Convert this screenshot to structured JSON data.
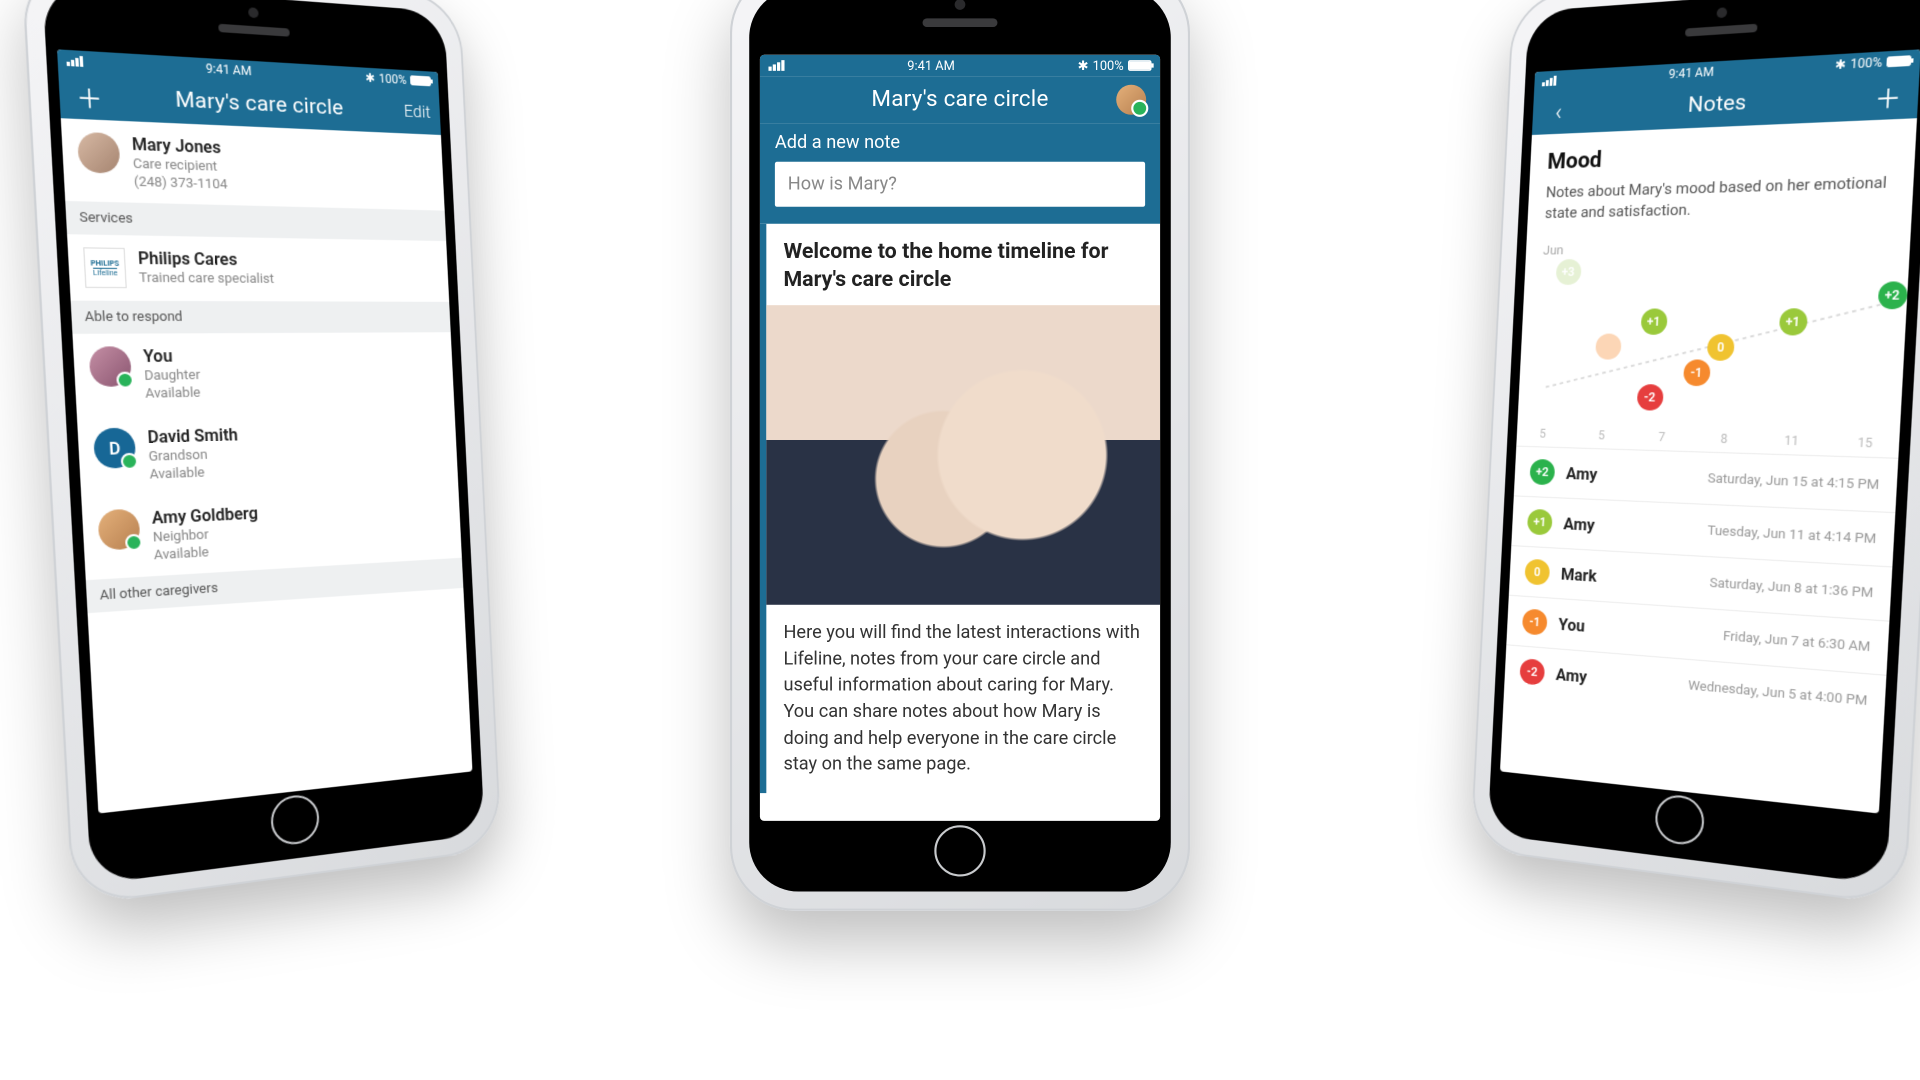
{
  "statusbar": {
    "time": "9:41 AM",
    "battery": "100%"
  },
  "phone1": {
    "nav": {
      "title": "Mary's care circle",
      "right": "Edit",
      "left_icon": "plus-icon"
    },
    "recipient": {
      "name": "Mary Jones",
      "role": "Care recipient",
      "phone": "(248) 373-1104"
    },
    "services_header": "Services",
    "service": {
      "name": "Philips Cares",
      "subtitle": "Trained care specialist",
      "badge_top": "PHILIPS",
      "badge_bottom": "Lifeline"
    },
    "respond_header": "Able to respond",
    "caregivers": [
      {
        "name": "You",
        "relation": "Daughter",
        "status": "Available",
        "avatar": "img3"
      },
      {
        "name": "David Smith",
        "relation": "Grandson",
        "status": "Available",
        "avatar": "img4",
        "initial": "D"
      },
      {
        "name": "Amy Goldberg",
        "relation": "Neighbor",
        "status": "Available",
        "avatar": "img2"
      }
    ],
    "others_header": "All other caregivers"
  },
  "phone2": {
    "nav": {
      "title": "Mary's care circle"
    },
    "add_note_label": "Add a new note",
    "add_note_placeholder": "How is Mary?",
    "timeline_title": "Welcome to the home timeline for Mary's care circle",
    "timeline_body": "Here you will find the latest interactions with Lifeline, notes from your care circle and useful information about caring for Mary. You can share notes about how Mary is doing and help everyone in the care circle stay on the same page."
  },
  "phone3": {
    "nav": {
      "title": "Notes",
      "left_icon": "back-icon",
      "right_icon": "plus-icon"
    },
    "heading": "Mood",
    "description": "Notes about Mary's mood based on her emotional state and satisfaction.",
    "entries": [
      {
        "score": "+2",
        "color": "c-green",
        "who": "Amy",
        "when": "Saturday, Jun 15 at 4:15 PM"
      },
      {
        "score": "+1",
        "color": "c-lime",
        "who": "Amy",
        "when": "Tuesday, Jun 11 at 4:14 PM"
      },
      {
        "score": "0",
        "color": "c-yellow",
        "who": "Mark",
        "when": "Saturday, Jun 8 at 1:36 PM"
      },
      {
        "score": "-1",
        "color": "c-orange",
        "who": "You",
        "when": "Friday, Jun 7 at 6:30 AM"
      },
      {
        "score": "-2",
        "color": "c-red",
        "who": "Amy",
        "when": "Wednesday, Jun 5 at 4:00 PM"
      }
    ]
  },
  "chart_data": {
    "type": "scatter",
    "title": "Mood",
    "month_label": "Jun",
    "x_ticks": [
      "5",
      "5",
      "7",
      "8",
      "11",
      "15"
    ],
    "points": [
      {
        "x": 1,
        "score": 3,
        "label": "+3",
        "color": "c-lgreen",
        "faded": true
      },
      {
        "x": 3,
        "score": 0,
        "label": "",
        "color": "c-orange",
        "faded": true
      },
      {
        "x": 5,
        "score": -2,
        "label": "-2",
        "color": "c-red",
        "faded": false
      },
      {
        "x": 5,
        "score": 1,
        "label": "+1",
        "color": "c-lime",
        "faded": false
      },
      {
        "x": 7,
        "score": -1,
        "label": "-1",
        "color": "c-orange",
        "faded": false
      },
      {
        "x": 8,
        "score": 0,
        "label": "0",
        "color": "c-yellow",
        "faded": false
      },
      {
        "x": 11,
        "score": 1,
        "label": "+1",
        "color": "c-lime",
        "faded": false
      },
      {
        "x": 15,
        "score": 2,
        "label": "+2",
        "color": "c-green",
        "faded": false
      }
    ],
    "x_range": [
      0,
      16
    ],
    "y_range": [
      -3,
      3
    ]
  }
}
